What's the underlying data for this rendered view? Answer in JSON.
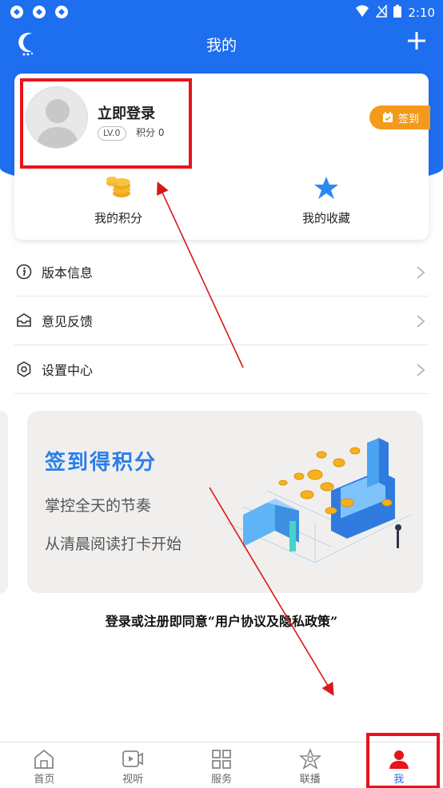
{
  "status_bar": {
    "time": "2:10"
  },
  "app_bar": {
    "title": "我的"
  },
  "profile": {
    "login_label": "立即登录",
    "level": "LV.0",
    "points_label": "积分 0",
    "signin_label": "签到"
  },
  "stats": [
    {
      "label": "我的积分",
      "icon": "coins-icon"
    },
    {
      "label": "我的收藏",
      "icon": "star-icon"
    }
  ],
  "menu": [
    {
      "label": "版本信息",
      "icon": "info-icon"
    },
    {
      "label": "意见反馈",
      "icon": "feedback-icon"
    },
    {
      "label": "设置中心",
      "icon": "settings-icon"
    }
  ],
  "banner": {
    "title": "签到得积分",
    "line1": "掌控全天的节奏",
    "line2": "从清晨阅读打卡开始"
  },
  "agreement": "登录或注册即同意“用户协议及隐私政策”",
  "bottom_nav": [
    {
      "label": "首页",
      "icon": "home-icon"
    },
    {
      "label": "视听",
      "icon": "video-icon"
    },
    {
      "label": "服务",
      "icon": "grid-icon"
    },
    {
      "label": "联播",
      "icon": "broadcast-icon"
    },
    {
      "label": "我",
      "icon": "user-icon",
      "active": true
    }
  ],
  "colors": {
    "header_blue": "#1e6ff0",
    "accent_orange": "#f39a1c",
    "highlight_red": "#e8131b",
    "banner_blue": "#2a7fe8"
  }
}
